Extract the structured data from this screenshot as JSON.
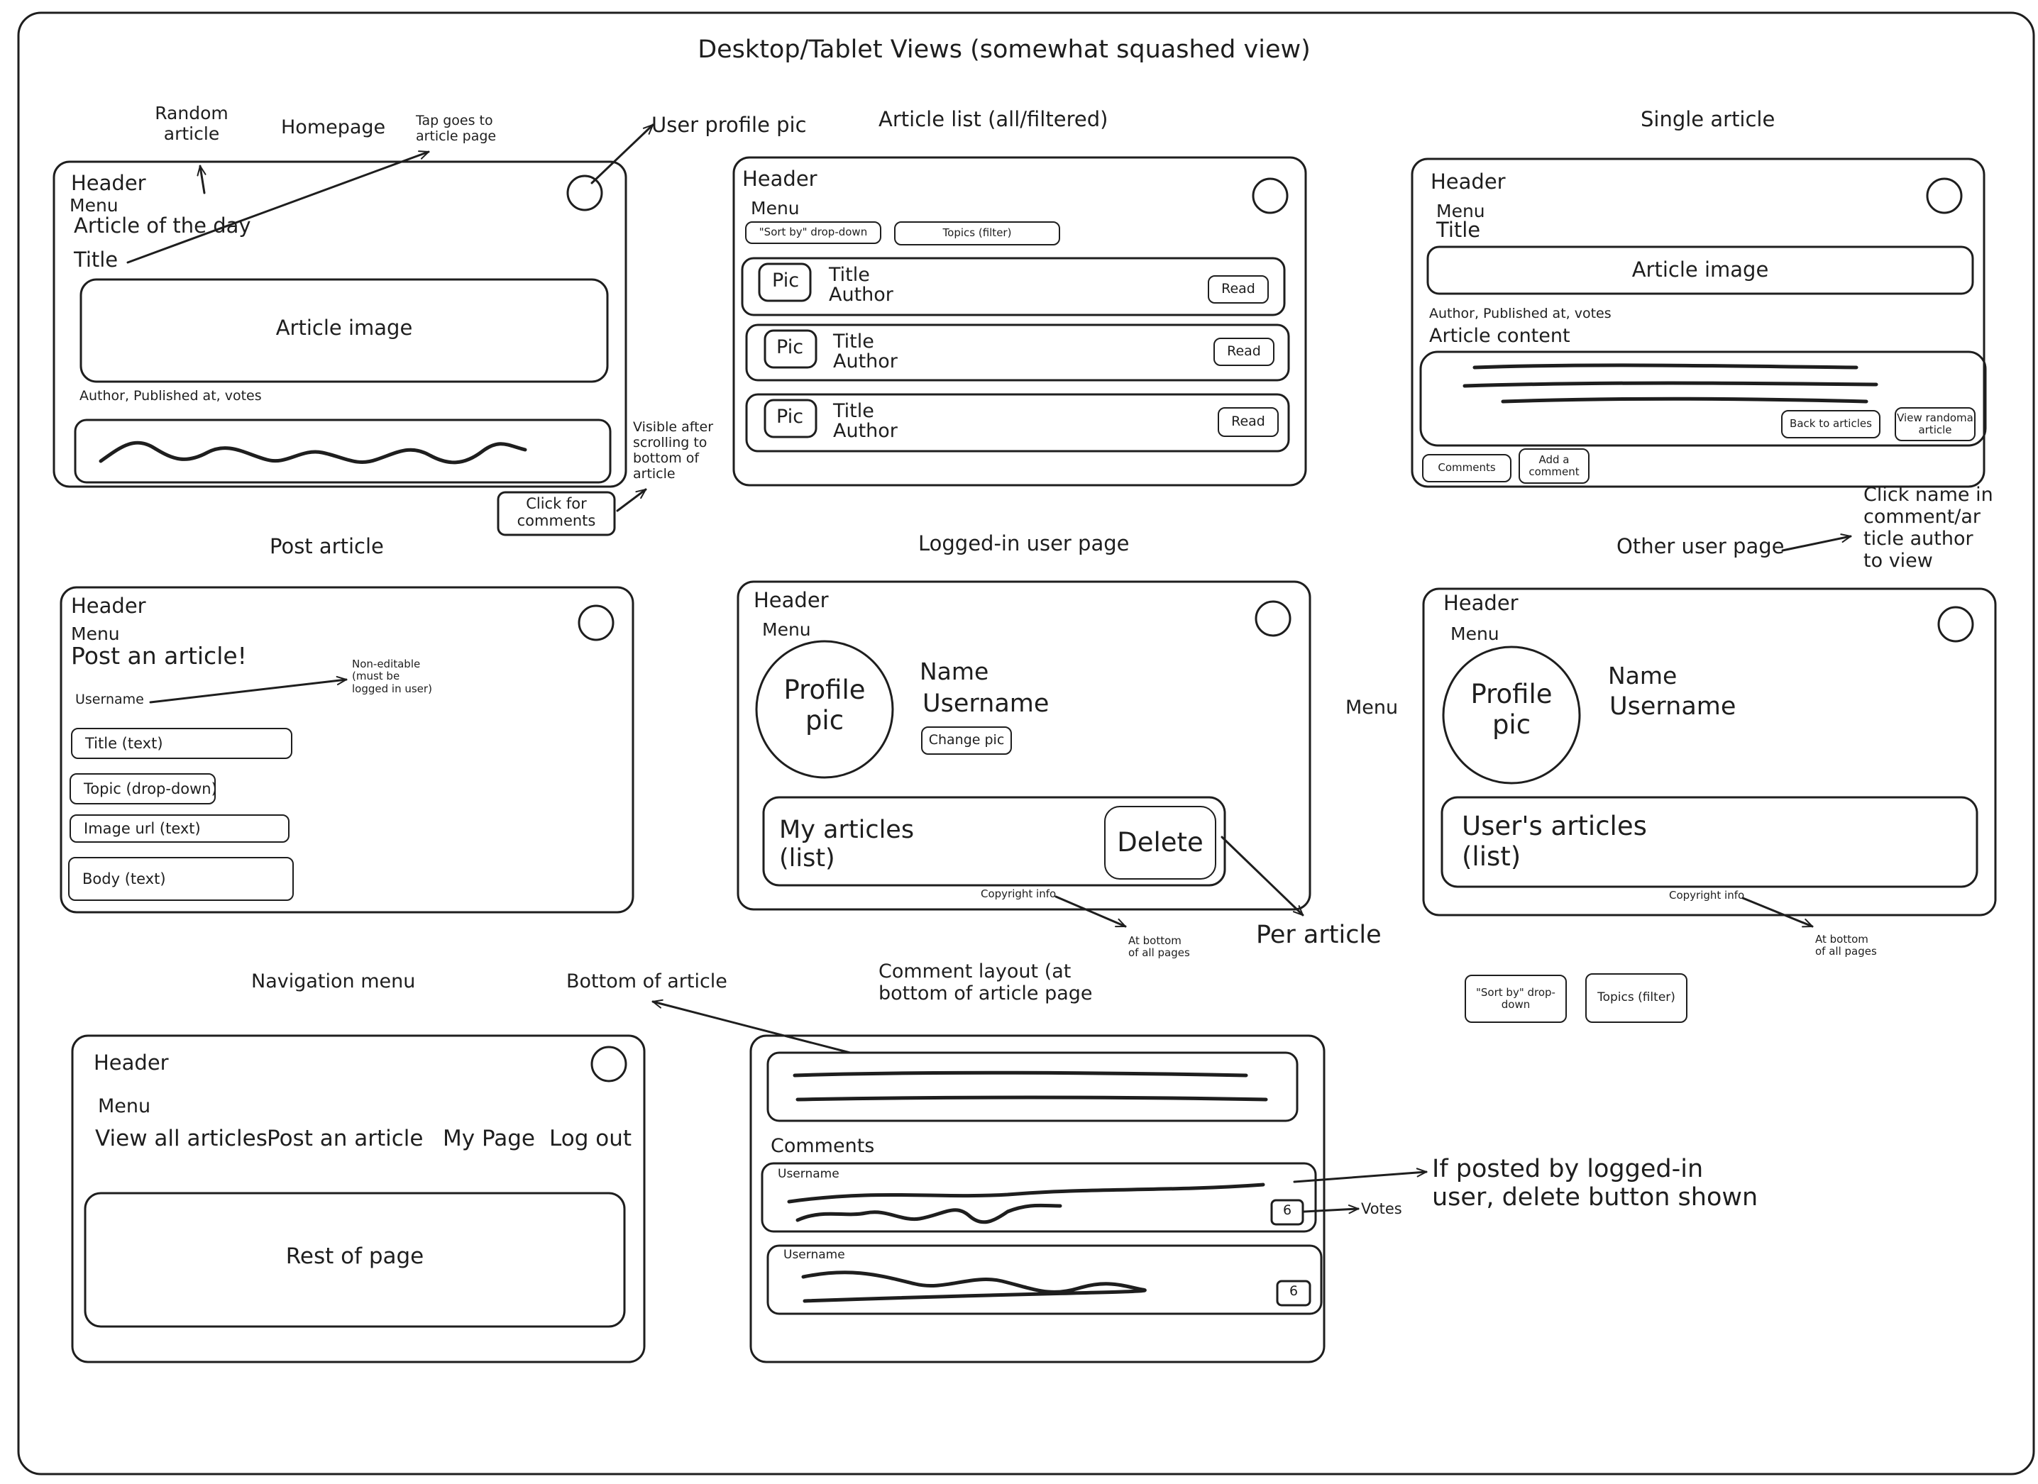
{
  "title": "Desktop/Tablet Views (somewhat squashed view)",
  "homepage": {
    "label": "Homepage",
    "random_article": "Random\narticle",
    "tap_note": "Tap goes to\narticle page",
    "profile_pic_note": "User profile pic",
    "header": "Header",
    "menu": "Menu",
    "article_of_day": "Article of the day",
    "title": "Title",
    "article_image": "Article image",
    "meta": "Author, Published at, votes",
    "visible_note": "Visible after\nscrolling to\nbottom of\narticle",
    "comments_button": "Click for\ncomments"
  },
  "article_list": {
    "label": "Article list (all/filtered)",
    "header": "Header",
    "menu": "Menu",
    "sort_by": "\"Sort by\" drop-down",
    "topics": "Topics (filter)",
    "items": [
      {
        "pic": "Pic",
        "title": "Title",
        "author": "Author",
        "read": "Read"
      },
      {
        "pic": "Pic",
        "title": "Title",
        "author": "Author",
        "read": "Read"
      },
      {
        "pic": "Pic",
        "title": "Title",
        "author": "Author",
        "read": "Read"
      }
    ]
  },
  "single_article": {
    "label": "Single article",
    "header": "Header",
    "menu": "Menu",
    "title": "Title",
    "article_image": "Article image",
    "meta": "Author, Published at, votes",
    "content_label": "Article content",
    "back_button": "Back to articles",
    "random_button": "View randoma\narticle",
    "comments_button": "Comments",
    "add_comment_button": "Add a\ncomment"
  },
  "post_article": {
    "label": "Post article",
    "header": "Header",
    "menu": "Menu",
    "heading": "Post an article!",
    "username": "Username",
    "non_editable_note": "Non-editable\n(must be\nlogged in user)",
    "fields": [
      "Title (text)",
      "Topic (drop-down)",
      "Image url (text)",
      "Body (text)"
    ]
  },
  "logged_in_page": {
    "label": "Logged-in user page",
    "header": "Header",
    "menu": "Menu",
    "profile_pic": "Profile\npic",
    "name": "Name",
    "username": "Username",
    "change_pic": "Change pic",
    "my_articles": "My articles\n(list)",
    "delete": "Delete",
    "copyright": "Copyright info",
    "bottom_note": "At bottom\nof all pages",
    "per_article": "Per article"
  },
  "other_user_page": {
    "label": "Other user page",
    "click_note": "Click name in\ncomment/ar\nticle author\nto view",
    "menu_outside": "Menu",
    "header": "Header",
    "menu": "Menu",
    "profile_pic": "Profile\npic",
    "name": "Name",
    "username": "Username",
    "users_articles": "User's articles\n(list)",
    "copyright": "Copyright info",
    "bottom_note": "At bottom\nof all pages",
    "sort_by": "\"Sort by\" drop-\ndown",
    "topics": "Topics (filter)"
  },
  "navigation_menu": {
    "label": "Navigation menu",
    "header": "Header",
    "menu": "Menu",
    "items": [
      "View all articles",
      "Post an article",
      "My Page",
      "Log out"
    ],
    "rest": "Rest of page"
  },
  "comment_layout": {
    "label": "Comment layout (at\nbottom of article page",
    "bottom_of_article": "Bottom of article",
    "comments_heading": "Comments",
    "comments": [
      {
        "username": "Username",
        "votes": "6"
      },
      {
        "username": "Username",
        "votes": "6"
      }
    ],
    "votes_label": "Votes",
    "delete_note": "If posted by logged-in\nuser, delete button shown"
  }
}
